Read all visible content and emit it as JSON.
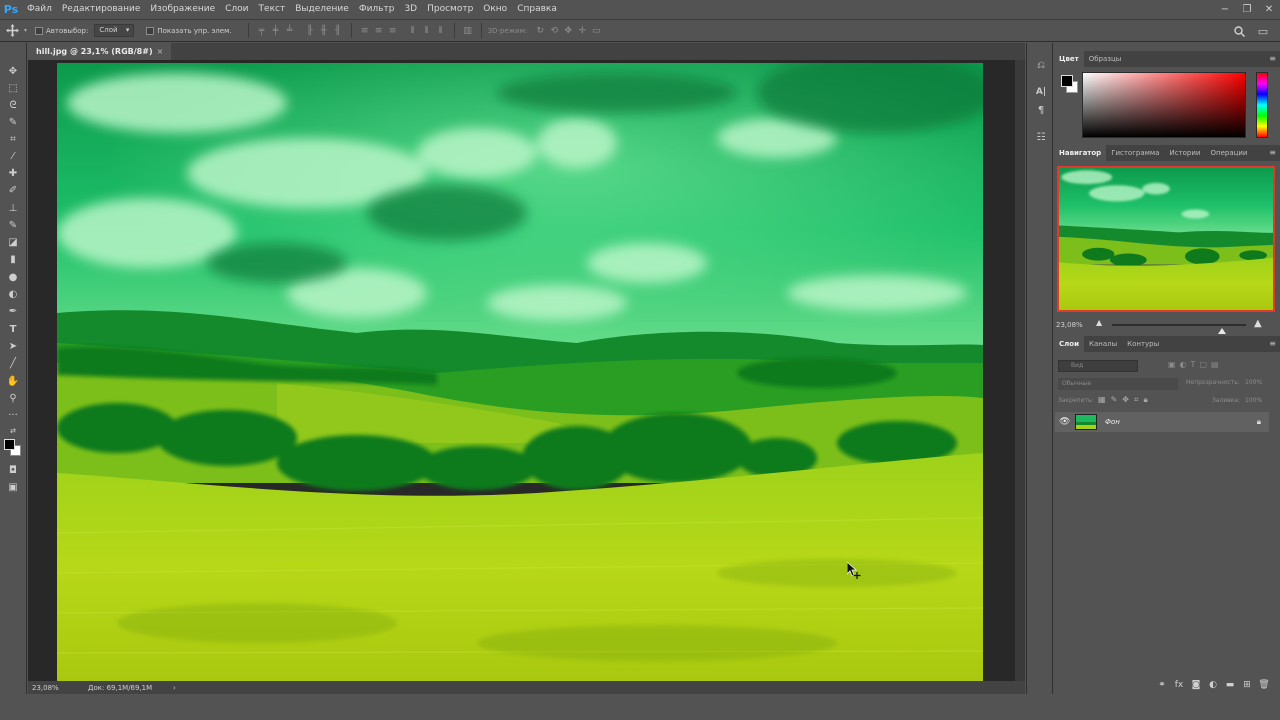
{
  "app": {
    "logo": "Ps"
  },
  "menu": [
    "Файл",
    "Редактирование",
    "Изображение",
    "Слои",
    "Текст",
    "Выделение",
    "Фильтр",
    "3D",
    "Просмотр",
    "Окно",
    "Справка"
  ],
  "window_controls": {
    "minimize": "−",
    "restore": "❐",
    "close": "✕"
  },
  "options": {
    "autoselect_label": "Автовыбор:",
    "autoselect_value": "Слой",
    "show_controls_label": "Показать упр. элем.",
    "mode3d_label": "3D-режим:"
  },
  "document": {
    "tab_title": "hill.jpg @ 23,1% (RGB/8#)",
    "tab_close": "×"
  },
  "status": {
    "zoom": "23,08%",
    "doc_info": "Док: 69,1M/69,1M",
    "arrow": "›"
  },
  "panels": {
    "color": {
      "tabs": [
        "Цвет",
        "Образцы"
      ]
    },
    "navigator": {
      "tabs": [
        "Навигатор",
        "Гистограмма",
        "Истории",
        "Операции"
      ],
      "zoom": "23,08%"
    },
    "layers": {
      "tabs": [
        "Слои",
        "Каналы",
        "Контуры"
      ],
      "search_placeholder": "Вид",
      "blend_mode": "Обычные",
      "opacity_label": "Непрозрачность:",
      "opacity_value": "100%",
      "lock_label": "Закрепить:",
      "fill_label": "Заливка:",
      "fill_value": "100%",
      "layer_name": "Фон"
    }
  },
  "colors": {
    "accent_blue": "#31a8ff",
    "navigator_frame": "#e03a2a",
    "foreground": "#000000",
    "background": "#ffffff"
  }
}
